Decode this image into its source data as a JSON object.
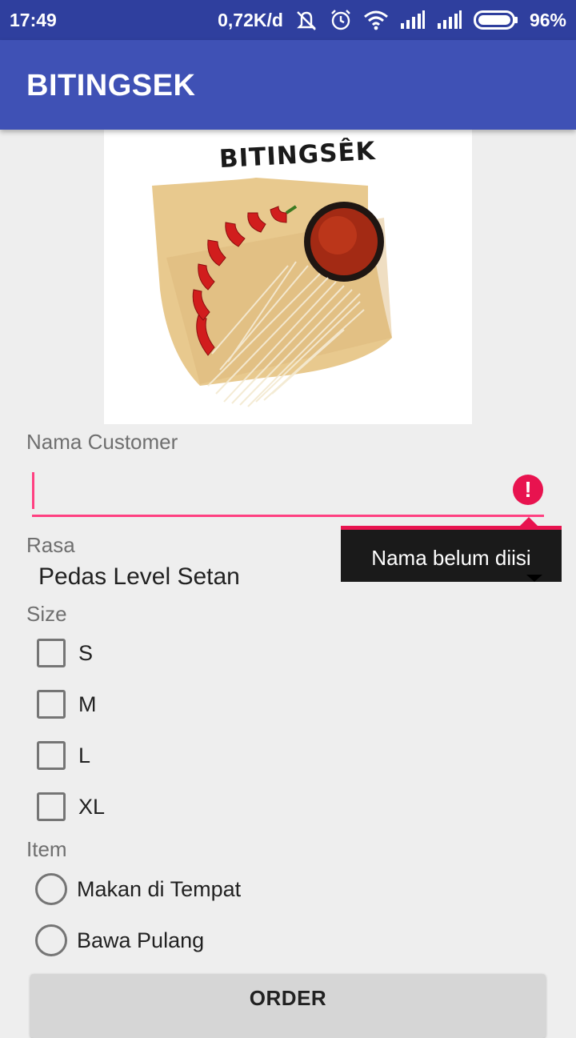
{
  "status_bar": {
    "time": "17:49",
    "net_speed": "0,72K/d",
    "battery": "96%",
    "icons": [
      "mute-icon",
      "alarm-icon",
      "wifi-icon",
      "signal-icon",
      "signal-icon",
      "battery-icon"
    ]
  },
  "app_bar": {
    "title": "BITINGSEK"
  },
  "hero": {
    "logo_text": "BITINGSÊK"
  },
  "form": {
    "name_label": "Nama Customer",
    "name_value": "",
    "name_error": "Nama belum diisi",
    "rasa_label": "Rasa",
    "rasa_value": "Pedas Level Setan",
    "size_label": "Size",
    "sizes": [
      {
        "label": "S",
        "checked": false
      },
      {
        "label": "M",
        "checked": false
      },
      {
        "label": "L",
        "checked": false
      },
      {
        "label": "XL",
        "checked": false
      }
    ],
    "item_label": "Item",
    "items": [
      {
        "label": "Makan di Tempat",
        "selected": false
      },
      {
        "label": "Bawa Pulang",
        "selected": false
      }
    ],
    "order_label": "ORDER"
  },
  "colors": {
    "primary": "#3f51b5",
    "primary_dark": "#2f3f9e",
    "accent": "#ff4081",
    "error": "#e8134f"
  }
}
